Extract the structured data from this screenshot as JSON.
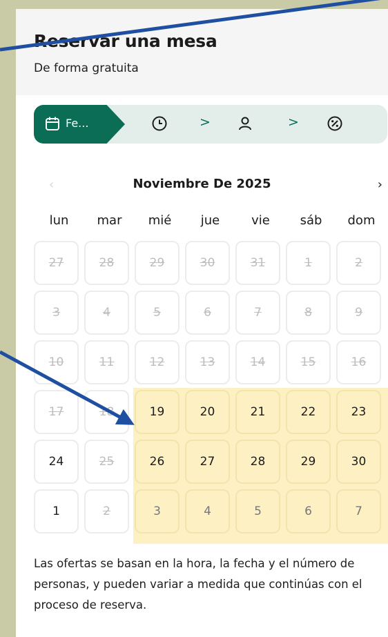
{
  "header": {
    "title": "Reservar una mesa",
    "subtitle": "De forma gratuita"
  },
  "stepper": {
    "active_label": "Fe...",
    "steps": [
      "calendar-icon",
      "clock-icon",
      "person-icon",
      "discount-icon"
    ],
    "separator": ">"
  },
  "calendar": {
    "month_label": "Noviembre De 2025",
    "prev": "‹",
    "next": "›",
    "weekdays": [
      "lun",
      "mar",
      "mié",
      "jue",
      "vie",
      "sáb",
      "dom"
    ],
    "weeks": [
      [
        {
          "d": "27",
          "s": "disabled"
        },
        {
          "d": "28",
          "s": "disabled"
        },
        {
          "d": "29",
          "s": "disabled"
        },
        {
          "d": "30",
          "s": "disabled"
        },
        {
          "d": "31",
          "s": "disabled"
        },
        {
          "d": "1",
          "s": "disabled"
        },
        {
          "d": "2",
          "s": "disabled"
        }
      ],
      [
        {
          "d": "3",
          "s": "disabled"
        },
        {
          "d": "4",
          "s": "disabled"
        },
        {
          "d": "5",
          "s": "disabled"
        },
        {
          "d": "6",
          "s": "disabled"
        },
        {
          "d": "7",
          "s": "disabled"
        },
        {
          "d": "8",
          "s": "disabled"
        },
        {
          "d": "9",
          "s": "disabled"
        }
      ],
      [
        {
          "d": "10",
          "s": "disabled"
        },
        {
          "d": "11",
          "s": "disabled"
        },
        {
          "d": "12",
          "s": "disabled"
        },
        {
          "d": "13",
          "s": "disabled"
        },
        {
          "d": "14",
          "s": "disabled"
        },
        {
          "d": "15",
          "s": "disabled"
        },
        {
          "d": "16",
          "s": "disabled"
        }
      ],
      [
        {
          "d": "17",
          "s": "disabled"
        },
        {
          "d": "18",
          "s": "disabled"
        },
        {
          "d": "19",
          "s": "highlight"
        },
        {
          "d": "20",
          "s": "highlight"
        },
        {
          "d": "21",
          "s": "highlight"
        },
        {
          "d": "22",
          "s": "highlight"
        },
        {
          "d": "23",
          "s": "highlight"
        }
      ],
      [
        {
          "d": "24",
          "s": "available"
        },
        {
          "d": "25",
          "s": "disabled"
        },
        {
          "d": "26",
          "s": "highlight"
        },
        {
          "d": "27",
          "s": "highlight"
        },
        {
          "d": "28",
          "s": "highlight"
        },
        {
          "d": "29",
          "s": "highlight"
        },
        {
          "d": "30",
          "s": "highlight"
        }
      ],
      [
        {
          "d": "1",
          "s": "available"
        },
        {
          "d": "2",
          "s": "disabled"
        },
        {
          "d": "3",
          "s": "highlight-faded"
        },
        {
          "d": "4",
          "s": "highlight-faded"
        },
        {
          "d": "5",
          "s": "highlight-faded"
        },
        {
          "d": "6",
          "s": "highlight-faded"
        },
        {
          "d": "7",
          "s": "highlight-faded"
        }
      ]
    ]
  },
  "footer": {
    "note": "Las ofertas se basan en la hora, la fecha y el número de personas, y pueden variar a medida que continúas con el proceso de reserva."
  },
  "colors": {
    "brand_green": "#0b6d55",
    "stepper_bg": "#e3eeea",
    "highlight": "#fdf0c3",
    "annotation_arrow": "#1f4fa0",
    "outer_bg": "#c9cba6"
  }
}
